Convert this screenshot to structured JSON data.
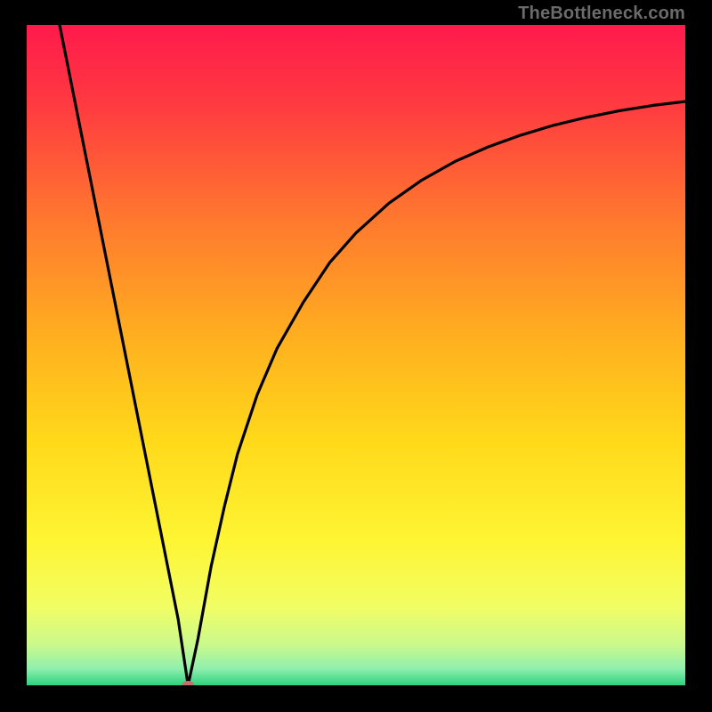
{
  "watermark": "TheBottleneck.com",
  "chart_data": {
    "type": "line",
    "title": "",
    "xlabel": "",
    "ylabel": "",
    "xlim": [
      0,
      100
    ],
    "ylim": [
      0,
      100
    ],
    "annotations": [],
    "background_gradient": {
      "stops": [
        {
          "pos": 0.0,
          "color": "#ff1a4c"
        },
        {
          "pos": 0.12,
          "color": "#ff3a40"
        },
        {
          "pos": 0.3,
          "color": "#ff7a2e"
        },
        {
          "pos": 0.48,
          "color": "#ffb11f"
        },
        {
          "pos": 0.63,
          "color": "#ffd91a"
        },
        {
          "pos": 0.78,
          "color": "#fef533"
        },
        {
          "pos": 0.88,
          "color": "#f2fd63"
        },
        {
          "pos": 0.94,
          "color": "#c9f98e"
        },
        {
          "pos": 0.975,
          "color": "#8fefae"
        },
        {
          "pos": 1.0,
          "color": "#2ed27d"
        }
      ]
    },
    "series": [
      {
        "name": "bottleneck-curve",
        "type": "line",
        "color": "#000000",
        "x": [
          5,
          7,
          9,
          11,
          13,
          15,
          17,
          19,
          21,
          23,
          24.5,
          26,
          28,
          30,
          32,
          35,
          38,
          42,
          46,
          50,
          55,
          60,
          65,
          70,
          75,
          80,
          85,
          90,
          95,
          100
        ],
        "y": [
          100,
          90,
          80,
          70,
          60,
          50,
          40,
          30,
          20,
          10,
          0,
          7,
          18,
          27,
          35,
          44,
          51,
          58,
          64,
          68.5,
          73,
          76.5,
          79.3,
          81.5,
          83.3,
          84.8,
          86,
          87,
          87.8,
          88.4
        ]
      }
    ],
    "marker": {
      "name": "min-point",
      "x": 24.5,
      "y": 0,
      "color": "#c6706a",
      "rx": 7,
      "ry": 5
    }
  }
}
